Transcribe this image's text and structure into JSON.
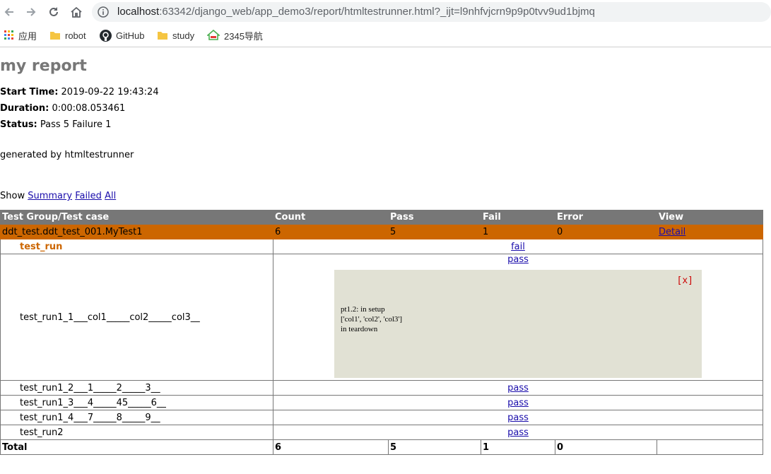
{
  "browser": {
    "url_host": "localhost",
    "url_rest": ":63342/django_web/app_demo3/report/htmltestrunner.html?_ijt=l9nhfvjcrn9p9p0tvv9ud1bjmq",
    "bookmarks": [
      {
        "label": "应用",
        "icon": "apps-grid-icon"
      },
      {
        "label": "robot",
        "icon": "folder-icon"
      },
      {
        "label": "GitHub",
        "icon": "github-icon"
      },
      {
        "label": "study",
        "icon": "folder-icon"
      },
      {
        "label": "2345导航",
        "icon": "2345-logo-icon"
      }
    ]
  },
  "report": {
    "title": "my report",
    "start_label": "Start Time:",
    "start_value": "2019-09-22 19:43:24",
    "duration_label": "Duration:",
    "duration_value": "0:00:08.053461",
    "status_label": "Status:",
    "status_value": "Pass 5 Failure 1",
    "description": "generated by htmltestrunner",
    "show_label": "Show",
    "show_links": [
      "Summary",
      "Failed",
      "All"
    ]
  },
  "table": {
    "headers": [
      "Test Group/Test case",
      "Count",
      "Pass",
      "Fail",
      "Error",
      "View"
    ],
    "class_row": [
      "ddt_test.ddt_test_001.MyTest1",
      "6",
      "5",
      "1",
      "0",
      "Detail"
    ],
    "cases": [
      {
        "name": "test_run",
        "status": "fail"
      },
      {
        "name": "test_run1_1___col1_____col2_____col3__",
        "status": "pass"
      },
      {
        "name": "test_run1_2___1_____2_____3__",
        "status": "pass"
      },
      {
        "name": "test_run1_3___4_____45_____6__",
        "status": "pass"
      },
      {
        "name": "test_run1_4___7_____8_____9__",
        "status": "pass"
      },
      {
        "name": "test_run2",
        "status": "pass"
      }
    ],
    "popup": {
      "close": "[x]",
      "output": "pt1.2: in setup\n['col1', 'col2', 'col3']\nin teardown"
    },
    "total_row": [
      "Total",
      "6",
      "5",
      "1",
      "0",
      ""
    ]
  }
}
